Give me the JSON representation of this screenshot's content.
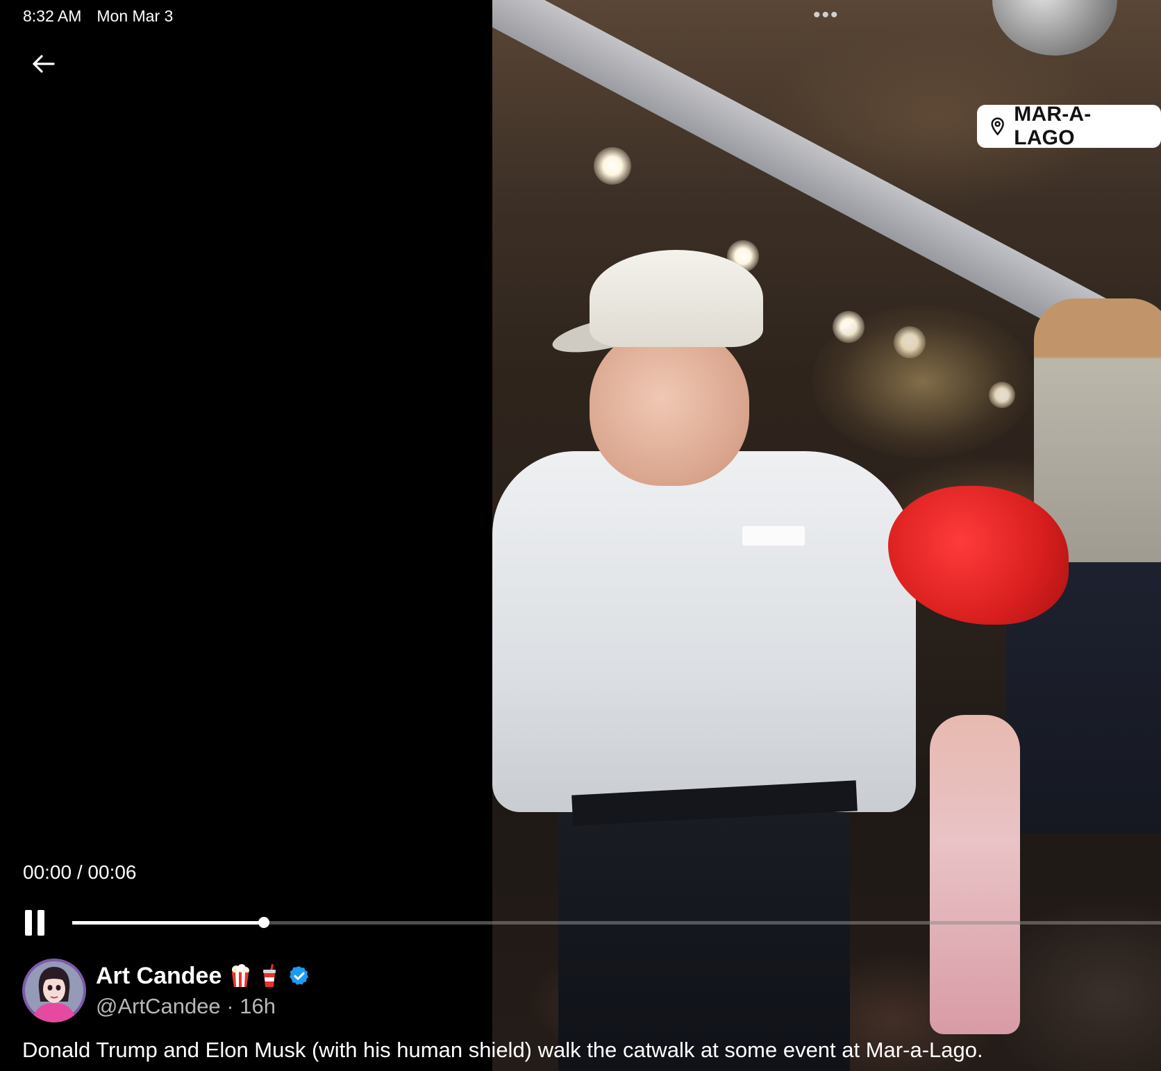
{
  "status_bar": {
    "time": "8:32 AM",
    "date": "Mon Mar 3"
  },
  "icons": {
    "back": "arrow-left-icon",
    "more": "more-dots-icon",
    "location": "map-pin-icon",
    "pause": "pause-icon",
    "verified": "verified-badge-icon",
    "popcorn": "popcorn-emoji",
    "cup": "soda-cup-emoji"
  },
  "player": {
    "current_time": "00:00",
    "separator": "/",
    "duration": "00:06",
    "progress_fraction": 0.176,
    "buffered_fraction": 0.149
  },
  "video": {
    "location_label": "MAR-A-LAGO"
  },
  "tweet": {
    "author_name": "Art Candee",
    "handle": "@ArtCandee",
    "time_ago": "16h",
    "text": "Donald Trump and Elon Musk (with his human shield) walk the catwalk at some event at Mar-a-Lago."
  },
  "colors": {
    "background": "#000000",
    "verified_blue": "#1D9BF0",
    "text_secondary": "#B8B8B8"
  }
}
